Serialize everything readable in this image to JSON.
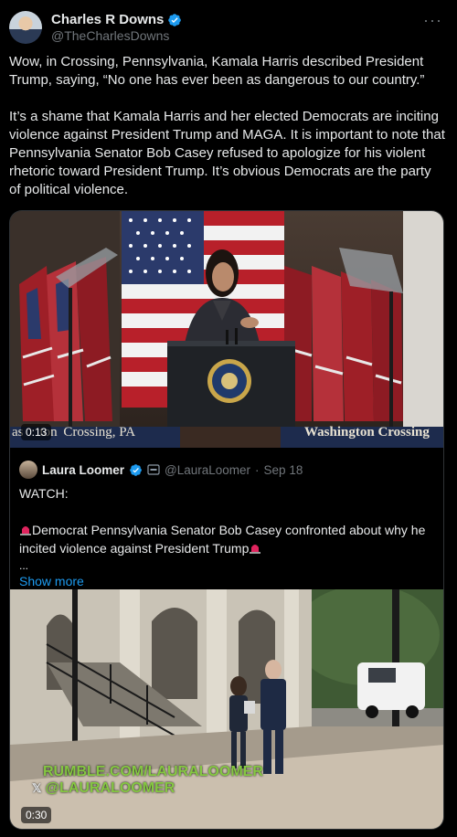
{
  "author": {
    "name": "Charles R Downs",
    "handle": "@TheCharlesDowns",
    "verified_color": "#1d9bf0",
    "more_icon": "more-horizontal-icon"
  },
  "tweet": {
    "paragraph1": "Wow, in Crossing, Pennsylvania, Kamala Harris described President Trump, saying, “No one has ever been as dangerous to our country.”",
    "paragraph2": "It’s a shame that Kamala Harris and her elected Democrats are inciting violence against President Trump and MAGA. It is important to note that Pennsylvania Senator Bob Casey refused to apologize for his violent rhetoric toward President Trump. It’s obvious Democrats are the party of political violence."
  },
  "video1": {
    "duration": "0:13",
    "banner_left": "Crossing, PA",
    "banner_left_partial": "as",
    "banner_left_partial2": "ton",
    "banner_right": "Washington Crossing"
  },
  "quote": {
    "name": "Laura Loomer",
    "handle": "@LauraLoomer",
    "separator": "·",
    "date": "Sep 18",
    "line1": "WATCH:",
    "line2": "Democrat Pennsylvania Senator Bob Casey confronted about why he incited violence against President Trump",
    "ellipsis": "...",
    "show_more": "Show more"
  },
  "video2": {
    "duration": "0:30",
    "watermark1": "RUMBLE.COM/LAURALOOMER",
    "watermark2": "@LAURALOOMER"
  },
  "colors": {
    "background": "#000000",
    "text": "#e7e9ea",
    "muted": "#71767b",
    "link": "#1d9bf0"
  }
}
